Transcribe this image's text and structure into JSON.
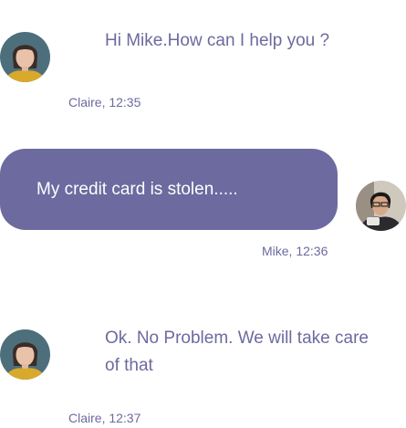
{
  "messages": [
    {
      "direction": "incoming",
      "text": "Hi Mike.How can I help you ?",
      "meta": "Claire, 12:35",
      "avatar_icon": "woman-avatar"
    },
    {
      "direction": "outgoing",
      "text": "My credit card is stolen.....",
      "meta": "Mike, 12:36",
      "avatar_icon": "man-avatar"
    },
    {
      "direction": "incoming",
      "text": "Ok. No Problem. We will take care of that",
      "meta": "Claire, 12:37",
      "avatar_icon": "woman-avatar"
    }
  ],
  "colors": {
    "accent": "#6c6a9f",
    "bubble_text": "#ffffff",
    "background": "#ffffff"
  }
}
